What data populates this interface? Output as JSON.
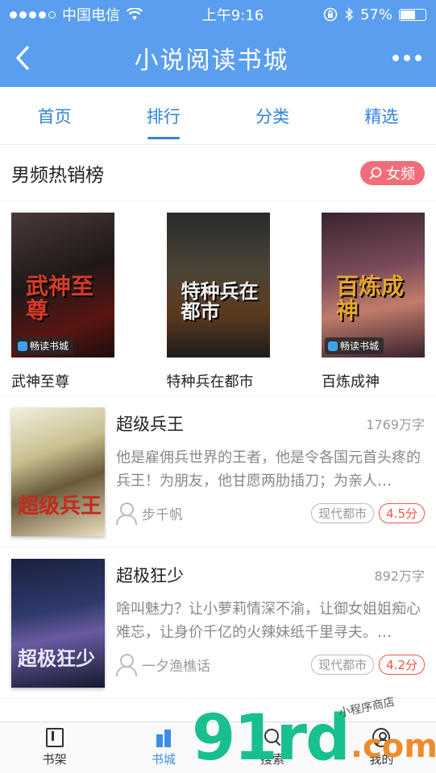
{
  "status": {
    "carrier": "中国电信",
    "time": "上午9:16",
    "battery": "57%",
    "battery_level": 0.57
  },
  "header": {
    "title": "小说阅读书城"
  },
  "tabs": [
    {
      "label": "首页",
      "active": false
    },
    {
      "label": "排行",
      "active": true
    },
    {
      "label": "分类",
      "active": false
    },
    {
      "label": "精选",
      "active": false
    }
  ],
  "section": {
    "title": "男频热销榜",
    "switch_label": "女频"
  },
  "top_books": [
    {
      "name": "武神至尊",
      "cover_text": "武神至尊",
      "badge": "畅读书城"
    },
    {
      "name": "特种兵在都市",
      "cover_text": "特种兵在都市",
      "badge": ""
    },
    {
      "name": "百炼成神",
      "cover_text": "百炼成神",
      "badge": "畅读书城"
    }
  ],
  "list": [
    {
      "title": "超级兵王",
      "words": "1769万字",
      "desc": "他是雇佣兵世界的王者，他是令各国元首头疼的兵王！为朋友，他甘愿两肋插刀；为亲人…",
      "author": "步千帆",
      "tag": "现代都市",
      "score": "4.5分",
      "cover_text": "超级兵王"
    },
    {
      "title": "超极狂少",
      "words": "892万字",
      "desc": "啥叫魅力？让小萝莉情深不渝，让御女姐姐痴心难忘，让身价千亿的火辣妹纸千里寻夫。…",
      "author": "一夕渔樵话",
      "tag": "现代都市",
      "score": "4.2分",
      "cover_text": "超极狂少"
    }
  ],
  "bottom_nav": [
    {
      "label": "书架",
      "icon": "bookshelf-icon",
      "active": false
    },
    {
      "label": "书城",
      "icon": "bookstore-icon",
      "active": true
    },
    {
      "label": "搜索",
      "icon": "search-icon",
      "active": false
    },
    {
      "label": "我的",
      "icon": "user-icon",
      "active": false
    }
  ],
  "watermark": {
    "brand": "91rd",
    "suffix": ".com",
    "note": "小程序商店"
  },
  "colors": {
    "header_bg": "#5a9ef0",
    "tab_text": "#2f83dc",
    "switch_bg": "#f06e7a",
    "score": "#ee5544"
  }
}
